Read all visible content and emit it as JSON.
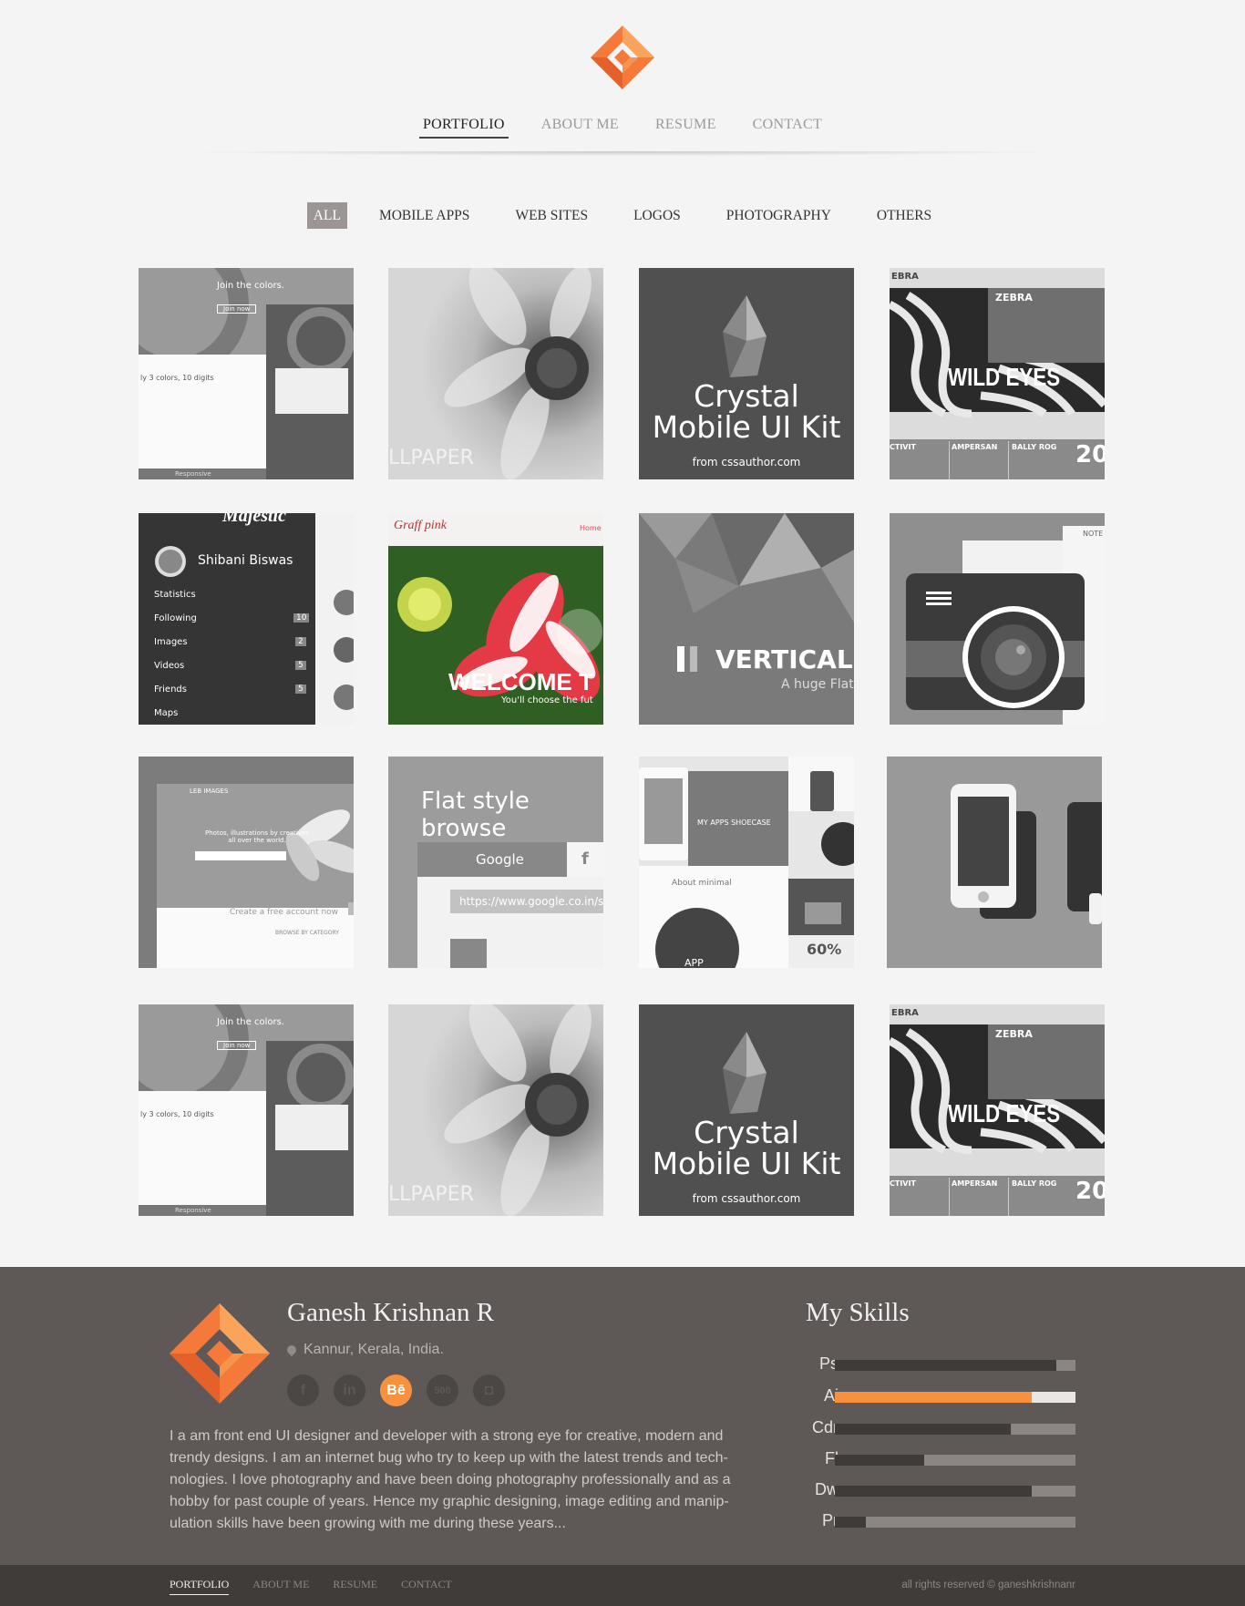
{
  "header": {
    "nav": [
      "PORTFOLIO",
      "ABOUT ME",
      "RESUME",
      "CONTACT"
    ],
    "active_nav": "PORTFOLIO"
  },
  "filters": {
    "items": [
      "ALL",
      "MOBILE APPS",
      "WEB SITES",
      "LOGOS",
      "PHOTOGRAPHY",
      "OTHERS"
    ],
    "active": "ALL"
  },
  "tiles": {
    "t1": {
      "heading": "Join the colors.",
      "button": "Join now",
      "text": "ly 3 colors, 10 digits",
      "foot": "Responsive"
    },
    "t2": {
      "text": "LLPAPER"
    },
    "t3": {
      "line1": "Crystal",
      "line2": "Mobile UI Kit",
      "line3": "from cssauthor.com"
    },
    "t4": {
      "brand": "EBRA",
      "logo": "ZEBRA",
      "title": "WILD EYES",
      "sub1": "CTIVIT",
      "sub2": "AMPERSAN",
      "sub3": "BALLY ROG",
      "num": "20"
    },
    "t5": {
      "brand": "Majestic",
      "name": "Shibani Biswas",
      "menu": [
        "Statistics",
        "Following",
        "Images",
        "Videos",
        "Friends",
        "Maps"
      ],
      "counts": [
        "",
        "10",
        "2",
        "5",
        "5",
        ""
      ]
    },
    "t6": {
      "brand": "Graff pink",
      "home": "Home",
      "title": "WELCOME T",
      "sub": "You'll choose the fut"
    },
    "t7": {
      "title": "VERTICAL",
      "sub": "A huge Flat"
    },
    "t8": {
      "label": "NOTE"
    },
    "t9": {
      "brand": "LEB IMAGES",
      "line": "Photos, illustrations by creatives all over the world.",
      "cta": "Create a free account now",
      "cat": "BROWSE BY CATEGORY"
    },
    "t10": {
      "title": "Flat style browse",
      "search": "Google",
      "url": "https://www.google.co.in/se"
    },
    "t11": {
      "title": "MY APPS SHOECASE",
      "about": "About minimal",
      "app": "APP",
      "percent": "60%"
    },
    "t12": {}
  },
  "footer": {
    "name": "Ganesh Krishnan R",
    "location": "Kannur, Kerala, India.",
    "socials": [
      "f",
      "in",
      "Bē",
      "500",
      "◘"
    ],
    "bio": "I a am front end UI designer and developer with a strong eye for creative, modern and trendy designs. I am an internet bug who try to keep up with the latest trends and tech-nologies. I love photography and have been doing photography professionally and as a hobby for past couple of years. Hence my graphic designing, image editing and manip-ulation skills have been growing with me during these years...",
    "skills_title": "My Skills",
    "skills": [
      {
        "name": "Ps",
        "value": 92
      },
      {
        "name": "Ai",
        "value": 82
      },
      {
        "name": "Cdr",
        "value": 73
      },
      {
        "name": "Fl",
        "value": 37
      },
      {
        "name": "Dw",
        "value": 82
      },
      {
        "name": "Pr",
        "value": 13
      }
    ],
    "accent": "#f7913d"
  },
  "bottom": {
    "nav": [
      "PORTFOLIO",
      "ABOUT ME",
      "RESUME",
      "CONTACT"
    ],
    "copyright": "all rights reserved © ganeshkrishnanr"
  }
}
